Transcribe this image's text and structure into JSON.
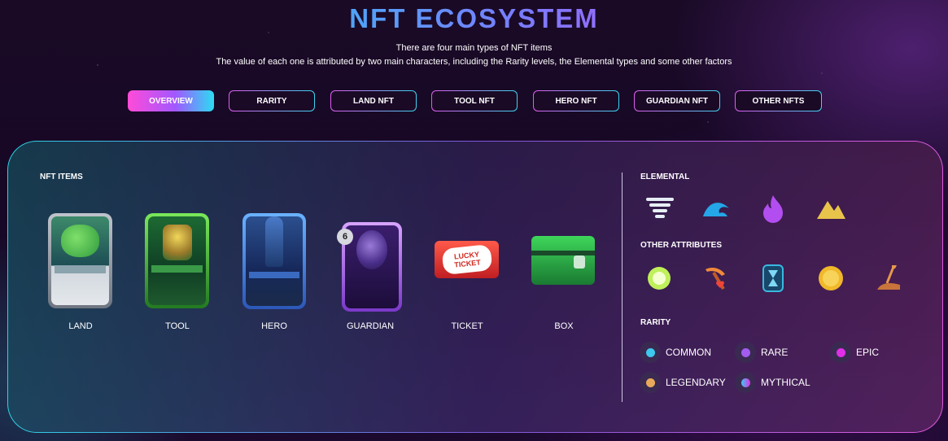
{
  "header": {
    "title": "NFT ECOSYSTEM",
    "subtitle_1": "There are four main types of NFT items",
    "subtitle_2": "The value of each one is attributed by two main characters, including the Rarity levels, the Elemental types and some other factors"
  },
  "tabs": [
    {
      "label": "OVERVIEW",
      "active": true
    },
    {
      "label": "RARITY"
    },
    {
      "label": "LAND NFT"
    },
    {
      "label": "TOOL NFT"
    },
    {
      "label": "HERO NFT"
    },
    {
      "label": "GUARDIAN NFT"
    },
    {
      "label": "OTHER NFTS"
    }
  ],
  "nft_items": {
    "heading": "NFT ITEMS",
    "items": [
      {
        "label": "LAND",
        "icon": "land-card-icon"
      },
      {
        "label": "TOOL",
        "icon": "tool-card-icon"
      },
      {
        "label": "HERO",
        "icon": "hero-card-icon"
      },
      {
        "label": "GUARDIAN",
        "icon": "guardian-card-icon",
        "badge": "6"
      },
      {
        "label": "TICKET",
        "icon": "lucky-ticket-icon",
        "ticket_text": "LUCKY TICKET"
      },
      {
        "label": "BOX",
        "icon": "green-chest-icon"
      }
    ]
  },
  "elemental": {
    "heading": "ELEMENTAL",
    "icons": [
      "wind-tornado-icon",
      "water-wave-icon",
      "fire-flame-icon",
      "earth-mountain-icon"
    ]
  },
  "other_attributes": {
    "heading": "OTHER ATTRIBUTES",
    "icons": [
      "energy-orb-icon",
      "pickaxe-heart-icon",
      "hourglass-icon",
      "gold-badge-icon",
      "shovel-dirt-icon"
    ]
  },
  "rarity": {
    "heading": "RARITY",
    "levels": [
      {
        "label": "COMMON",
        "color": "#3ec9ef"
      },
      {
        "label": "RARE",
        "color": "#a25cf0"
      },
      {
        "label": "EPIC",
        "color": "#e12ee8"
      },
      {
        "label": "LEGENDARY",
        "color": "#e9a95a"
      },
      {
        "label": "MYTHICAL",
        "color": "#b35cf0"
      }
    ]
  },
  "colors": {
    "accent_cyan": "#2dd3e6",
    "accent_magenta": "#e05ae0",
    "accent_purple": "#a258ff"
  }
}
